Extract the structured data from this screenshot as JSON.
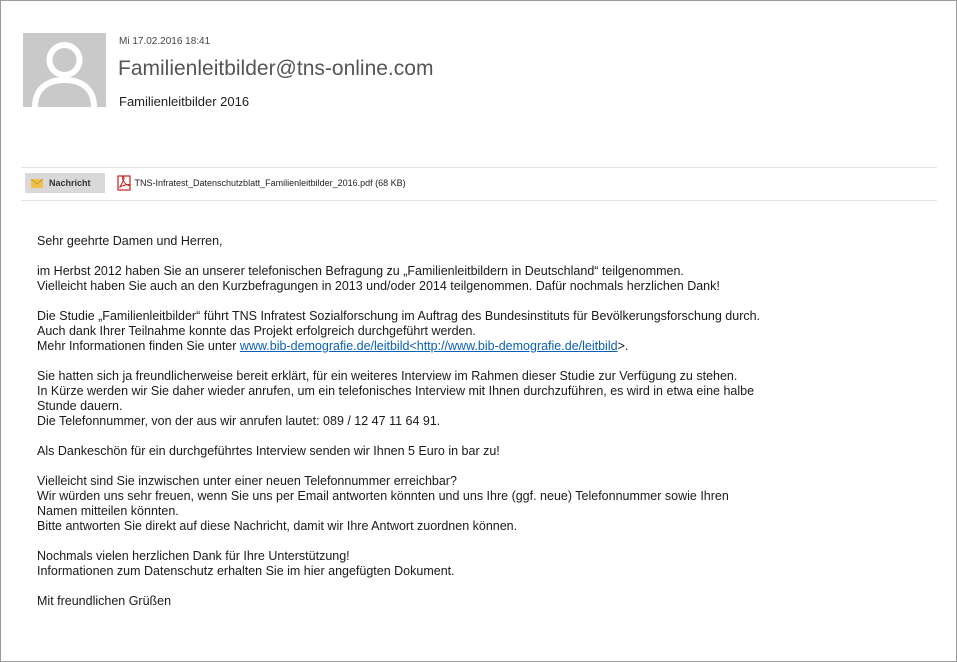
{
  "header": {
    "date": "Mi 17.02.2016 18:41",
    "from": "Familienleitbilder@tns-online.com",
    "subject": "Familienleitbilder 2016"
  },
  "attachments": {
    "message_tab": "Nachricht",
    "file": "TNS-Infratest_Datenschutzblatt_Familienleitbilder_2016.pdf (68 KB)"
  },
  "body": {
    "greeting": "Sehr geehrte Damen und Herren,",
    "p1_l1": "im Herbst 2012 haben Sie an unserer telefonischen Befragung zu „Familienleitbildern in Deutschland“ teilgenommen.",
    "p1_l2": "Vielleicht haben Sie auch an den Kurzbefragungen in 2013 und/oder 2014 teilgenommen. Dafür nochmals herzlichen Dank!",
    "p2_l1": "Die Studie „Familienleitbilder“ führt TNS Infratest Sozialforschung im Auftrag des Bundesinstituts für Bevölkerungsforschung durch.",
    "p2_l2": "Auch dank Ihrer Teilnahme konnte das Projekt erfolgreich durchgeführt werden.",
    "p2_l3_prefix": "Mehr Informationen finden Sie unter ",
    "p2_link1": "www.bib-demografie.de/leitbild",
    "p2_link_mid": "<",
    "p2_link2": "http://www.bib-demografie.de/leitbild",
    "p2_l3_suffix": ">.",
    "p3_l1": "Sie hatten sich ja freundlicherweise bereit erklärt, für ein weiteres Interview im Rahmen dieser Studie zur Verfügung zu stehen.",
    "p3_l2": "In Kürze werden wir Sie daher wieder anrufen, um ein telefonisches Interview mit Ihnen durchzuführen, es wird in etwa eine halbe",
    "p3_l3": "Stunde dauern.",
    "p3_l4": "Die Telefonnummer, von der aus wir anrufen lautet: 089 / 12 47 11 64 91.",
    "p4": "Als Dankeschön für ein durchgeführtes Interview senden wir Ihnen 5 Euro in bar zu!",
    "p5_l1": "Vielleicht sind Sie inzwischen unter einer neuen Telefonnummer erreichbar?",
    "p5_l2": "Wir würden uns sehr freuen, wenn Sie uns per Email antworten könnten und uns Ihre (ggf. neue) Telefonnummer sowie Ihren",
    "p5_l3": "Namen mitteilen könnten.",
    "p5_l4": "Bitte antworten Sie direkt auf diese Nachricht, damit wir Ihre Antwort zuordnen können.",
    "p6_l1": "Nochmals vielen herzlichen Dank für Ihre Unterstützung!",
    "p6_l2": "Informationen zum Datenschutz erhalten Sie im hier angefügten Dokument.",
    "closing": "Mit freundlichen Grüßen"
  },
  "colors": {
    "link": "#0b5fb5",
    "avatar_bg": "#c9c9c9",
    "tab_bg": "#d9d9d9",
    "pdf_red": "#c8201e"
  },
  "icons": {
    "avatar": "person-silhouette-icon",
    "message": "envelope-icon",
    "attachment": "pdf-icon"
  }
}
